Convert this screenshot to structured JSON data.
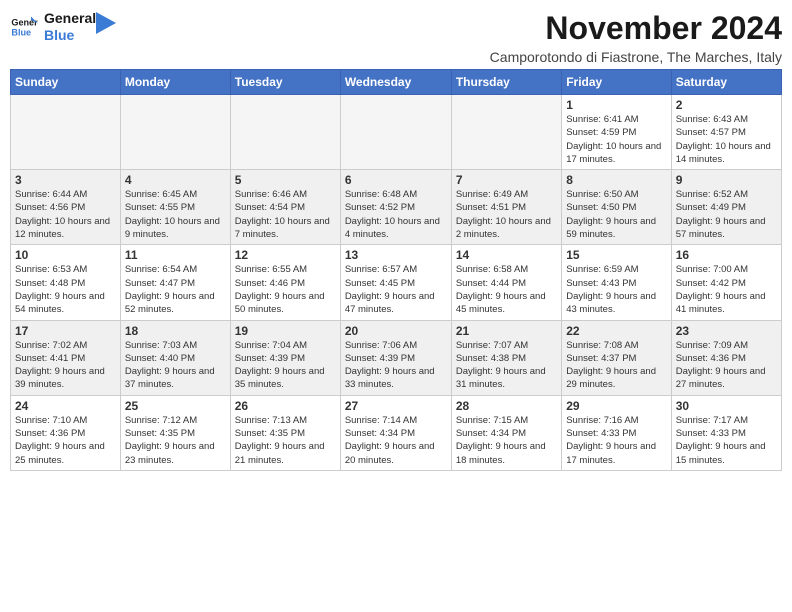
{
  "logo": {
    "line1": "General",
    "line2": "Blue"
  },
  "title": "November 2024",
  "subtitle": "Camporotondo di Fiastrone, The Marches, Italy",
  "days_of_week": [
    "Sunday",
    "Monday",
    "Tuesday",
    "Wednesday",
    "Thursday",
    "Friday",
    "Saturday"
  ],
  "weeks": [
    [
      {
        "day": "",
        "info": ""
      },
      {
        "day": "",
        "info": ""
      },
      {
        "day": "",
        "info": ""
      },
      {
        "day": "",
        "info": ""
      },
      {
        "day": "",
        "info": ""
      },
      {
        "day": "1",
        "info": "Sunrise: 6:41 AM\nSunset: 4:59 PM\nDaylight: 10 hours and 17 minutes."
      },
      {
        "day": "2",
        "info": "Sunrise: 6:43 AM\nSunset: 4:57 PM\nDaylight: 10 hours and 14 minutes."
      }
    ],
    [
      {
        "day": "3",
        "info": "Sunrise: 6:44 AM\nSunset: 4:56 PM\nDaylight: 10 hours and 12 minutes."
      },
      {
        "day": "4",
        "info": "Sunrise: 6:45 AM\nSunset: 4:55 PM\nDaylight: 10 hours and 9 minutes."
      },
      {
        "day": "5",
        "info": "Sunrise: 6:46 AM\nSunset: 4:54 PM\nDaylight: 10 hours and 7 minutes."
      },
      {
        "day": "6",
        "info": "Sunrise: 6:48 AM\nSunset: 4:52 PM\nDaylight: 10 hours and 4 minutes."
      },
      {
        "day": "7",
        "info": "Sunrise: 6:49 AM\nSunset: 4:51 PM\nDaylight: 10 hours and 2 minutes."
      },
      {
        "day": "8",
        "info": "Sunrise: 6:50 AM\nSunset: 4:50 PM\nDaylight: 9 hours and 59 minutes."
      },
      {
        "day": "9",
        "info": "Sunrise: 6:52 AM\nSunset: 4:49 PM\nDaylight: 9 hours and 57 minutes."
      }
    ],
    [
      {
        "day": "10",
        "info": "Sunrise: 6:53 AM\nSunset: 4:48 PM\nDaylight: 9 hours and 54 minutes."
      },
      {
        "day": "11",
        "info": "Sunrise: 6:54 AM\nSunset: 4:47 PM\nDaylight: 9 hours and 52 minutes."
      },
      {
        "day": "12",
        "info": "Sunrise: 6:55 AM\nSunset: 4:46 PM\nDaylight: 9 hours and 50 minutes."
      },
      {
        "day": "13",
        "info": "Sunrise: 6:57 AM\nSunset: 4:45 PM\nDaylight: 9 hours and 47 minutes."
      },
      {
        "day": "14",
        "info": "Sunrise: 6:58 AM\nSunset: 4:44 PM\nDaylight: 9 hours and 45 minutes."
      },
      {
        "day": "15",
        "info": "Sunrise: 6:59 AM\nSunset: 4:43 PM\nDaylight: 9 hours and 43 minutes."
      },
      {
        "day": "16",
        "info": "Sunrise: 7:00 AM\nSunset: 4:42 PM\nDaylight: 9 hours and 41 minutes."
      }
    ],
    [
      {
        "day": "17",
        "info": "Sunrise: 7:02 AM\nSunset: 4:41 PM\nDaylight: 9 hours and 39 minutes."
      },
      {
        "day": "18",
        "info": "Sunrise: 7:03 AM\nSunset: 4:40 PM\nDaylight: 9 hours and 37 minutes."
      },
      {
        "day": "19",
        "info": "Sunrise: 7:04 AM\nSunset: 4:39 PM\nDaylight: 9 hours and 35 minutes."
      },
      {
        "day": "20",
        "info": "Sunrise: 7:06 AM\nSunset: 4:39 PM\nDaylight: 9 hours and 33 minutes."
      },
      {
        "day": "21",
        "info": "Sunrise: 7:07 AM\nSunset: 4:38 PM\nDaylight: 9 hours and 31 minutes."
      },
      {
        "day": "22",
        "info": "Sunrise: 7:08 AM\nSunset: 4:37 PM\nDaylight: 9 hours and 29 minutes."
      },
      {
        "day": "23",
        "info": "Sunrise: 7:09 AM\nSunset: 4:36 PM\nDaylight: 9 hours and 27 minutes."
      }
    ],
    [
      {
        "day": "24",
        "info": "Sunrise: 7:10 AM\nSunset: 4:36 PM\nDaylight: 9 hours and 25 minutes."
      },
      {
        "day": "25",
        "info": "Sunrise: 7:12 AM\nSunset: 4:35 PM\nDaylight: 9 hours and 23 minutes."
      },
      {
        "day": "26",
        "info": "Sunrise: 7:13 AM\nSunset: 4:35 PM\nDaylight: 9 hours and 21 minutes."
      },
      {
        "day": "27",
        "info": "Sunrise: 7:14 AM\nSunset: 4:34 PM\nDaylight: 9 hours and 20 minutes."
      },
      {
        "day": "28",
        "info": "Sunrise: 7:15 AM\nSunset: 4:34 PM\nDaylight: 9 hours and 18 minutes."
      },
      {
        "day": "29",
        "info": "Sunrise: 7:16 AM\nSunset: 4:33 PM\nDaylight: 9 hours and 17 minutes."
      },
      {
        "day": "30",
        "info": "Sunrise: 7:17 AM\nSunset: 4:33 PM\nDaylight: 9 hours and 15 minutes."
      }
    ]
  ]
}
